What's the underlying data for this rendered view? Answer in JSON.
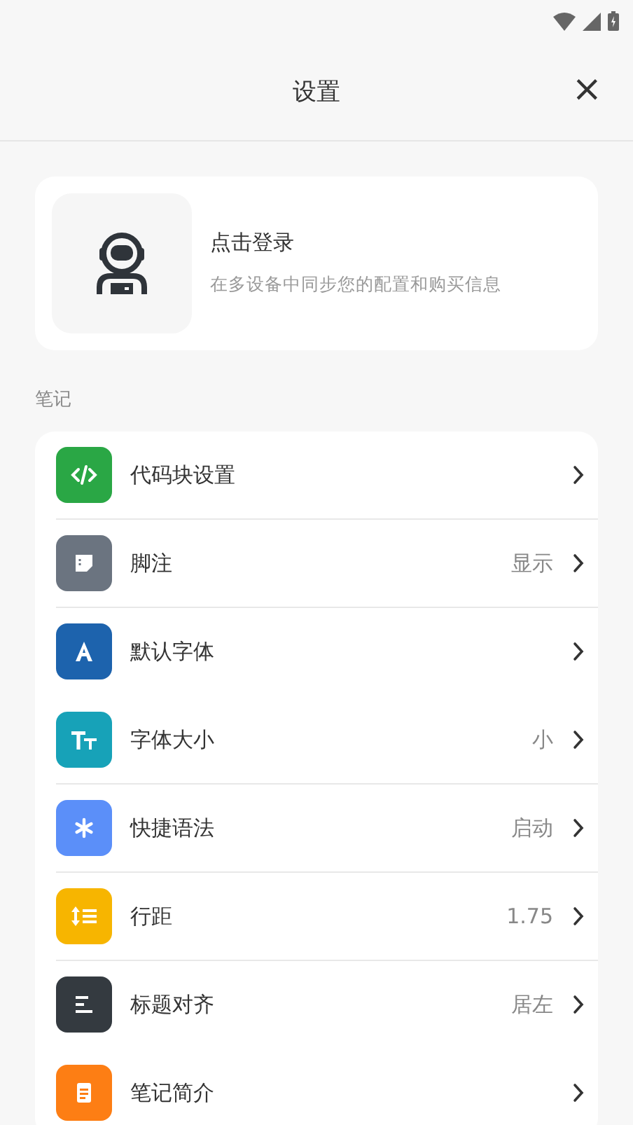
{
  "header": {
    "title": "设置",
    "close": "×"
  },
  "account": {
    "title": "点击登录",
    "subtitle": "在多设备中同步您的配置和购买信息"
  },
  "section": {
    "label": "笔记"
  },
  "items": [
    {
      "kind": "code",
      "label": "代码块设置",
      "color": "#2aa745",
      "divider": true
    },
    {
      "kind": "note",
      "label": "脚注",
      "value": "显示",
      "color": "#6b7480",
      "divider": true
    },
    {
      "kind": "font",
      "label": "默认字体",
      "color": "#1d63ad",
      "divider": false
    },
    {
      "kind": "size",
      "label": "字体大小",
      "value": "小",
      "color": "#17a2b8",
      "divider": true
    },
    {
      "kind": "star",
      "label": "快捷语法",
      "value": "启动",
      "color": "#5b8ff9",
      "divider": true
    },
    {
      "kind": "spacing",
      "label": "行距",
      "value": "1.75",
      "color": "#f7b500",
      "divider": true
    },
    {
      "kind": "align",
      "label": "标题对齐",
      "value": "居左",
      "color": "#343a40",
      "divider": false
    },
    {
      "kind": "doc",
      "label": "笔记简介",
      "color": "#fd7e14"
    }
  ]
}
